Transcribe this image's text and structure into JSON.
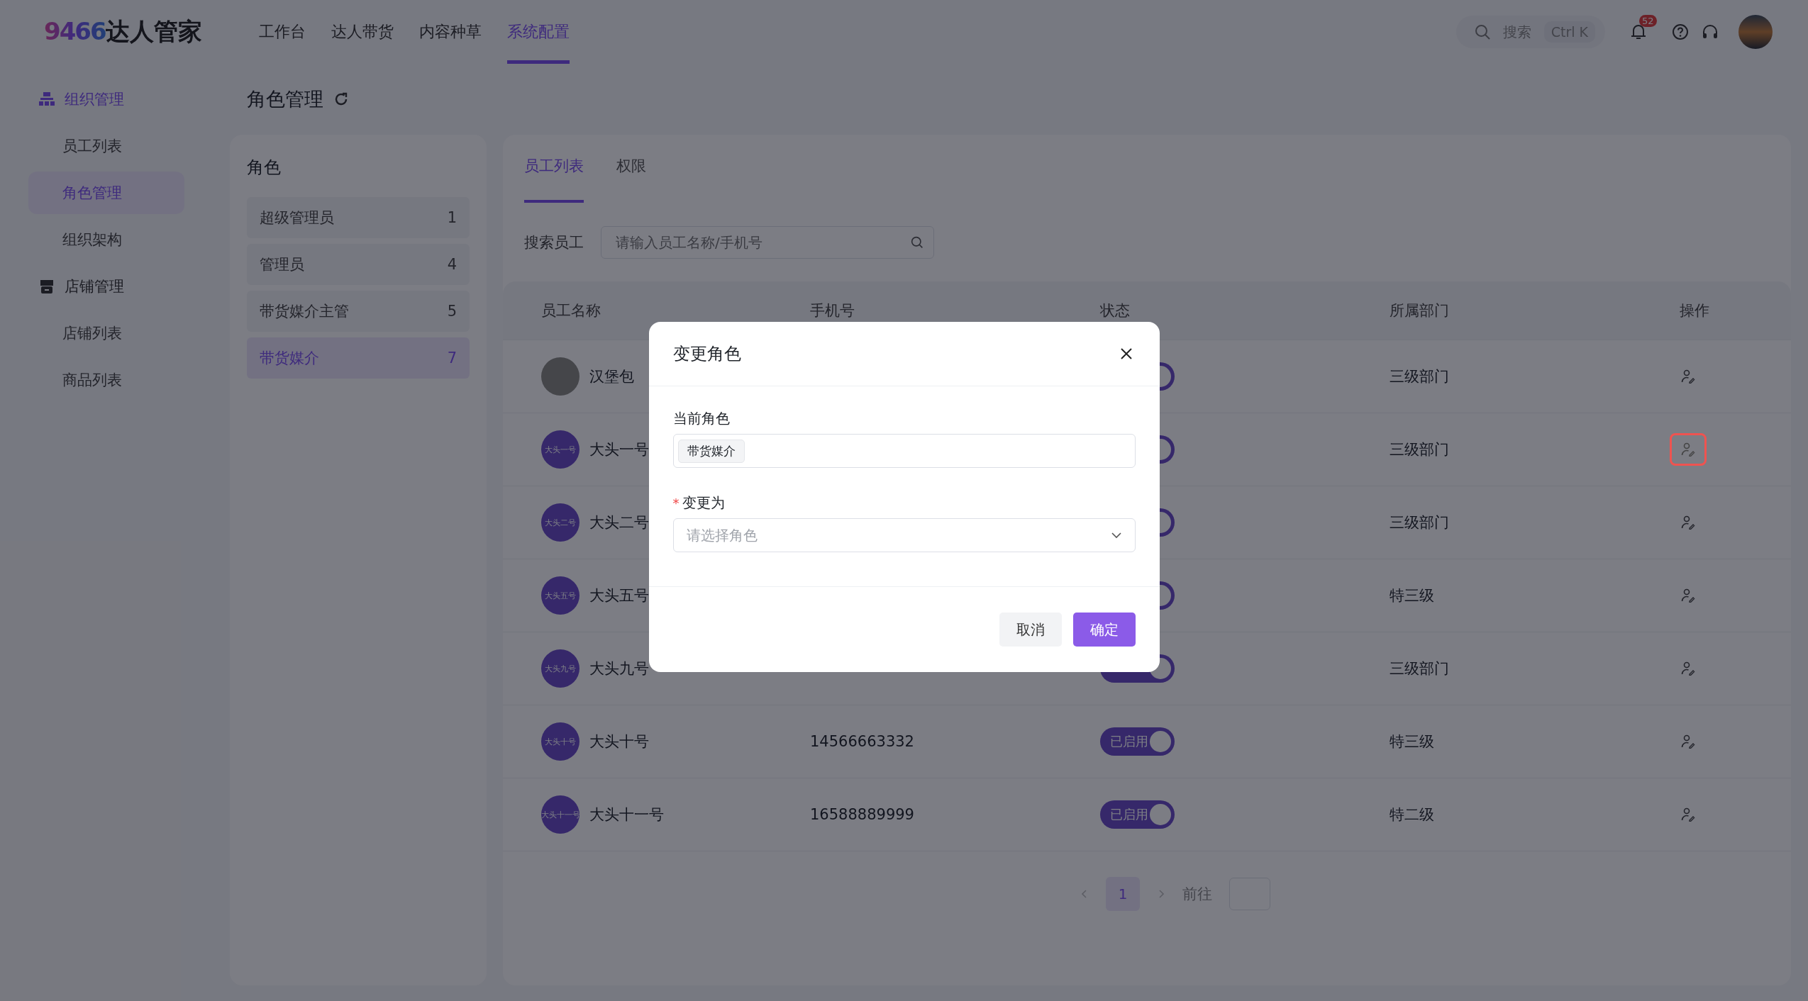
{
  "header": {
    "logo_digits": "9466",
    "logo_text": "达人管家",
    "nav": [
      {
        "label": "工作台",
        "selected": false
      },
      {
        "label": "达人带货",
        "selected": false
      },
      {
        "label": "内容种草",
        "selected": false
      },
      {
        "label": "系统配置",
        "selected": true
      }
    ],
    "search": {
      "placeholder": "搜索",
      "shortcut": "Ctrl K"
    },
    "notification_count": "52"
  },
  "sidebar": {
    "groups": [
      {
        "label": "组织管理",
        "kind": "org",
        "selected": true,
        "items": [
          {
            "label": "员工列表",
            "selected": false
          },
          {
            "label": "角色管理",
            "selected": true
          },
          {
            "label": "组织架构",
            "selected": false
          }
        ]
      },
      {
        "label": "店铺管理",
        "kind": "store",
        "selected": false,
        "items": [
          {
            "label": "店铺列表",
            "selected": false
          },
          {
            "label": "商品列表",
            "selected": false
          }
        ]
      }
    ]
  },
  "page": {
    "title": "角色管理"
  },
  "roles": {
    "title": "角色",
    "items": [
      {
        "name": "超级管理员",
        "count": "1",
        "selected": false
      },
      {
        "name": "管理员",
        "count": "4",
        "selected": false
      },
      {
        "name": "带货媒介主管",
        "count": "5",
        "selected": false
      },
      {
        "name": "带货媒介",
        "count": "7",
        "selected": true
      }
    ]
  },
  "tabs": [
    {
      "label": "员工列表",
      "selected": true
    },
    {
      "label": "权限",
      "selected": false
    }
  ],
  "search": {
    "label": "搜索员工",
    "placeholder": "请输入员工名称/手机号"
  },
  "table": {
    "columns": [
      "员工名称",
      "手机号",
      "状态",
      "所属部门",
      "操作"
    ],
    "rows": [
      {
        "avatar": {
          "kind": "photo"
        },
        "name": "汉堡包",
        "enabled": true,
        "department": "三级部门",
        "highlighted": false
      },
      {
        "avatar": {
          "kind": "text",
          "text": "大头一号"
        },
        "name": "大头一号",
        "enabled": true,
        "department": "三级部门",
        "highlighted": true
      },
      {
        "avatar": {
          "kind": "text",
          "text": "大头二号"
        },
        "name": "大头二号",
        "enabled": true,
        "department": "三级部门",
        "highlighted": false
      },
      {
        "avatar": {
          "kind": "text",
          "text": "大头五号"
        },
        "name": "大头五号",
        "enabled": true,
        "department": "特三级",
        "highlighted": false
      },
      {
        "avatar": {
          "kind": "text",
          "text": "大头九号"
        },
        "name": "大头九号",
        "enabled": true,
        "department": "三级部门",
        "highlighted": false
      },
      {
        "avatar": {
          "kind": "text",
          "text": "大头十号"
        },
        "name": "大头十号",
        "phone": "14566663332",
        "enabled": true,
        "status_label": "已启用",
        "department": "特三级",
        "highlighted": false
      },
      {
        "avatar": {
          "kind": "text",
          "text": "大头十一号"
        },
        "name": "大头十一号",
        "phone": "16588889999",
        "enabled": true,
        "status_label": "已启用",
        "department": "特二级",
        "highlighted": false
      }
    ]
  },
  "pagination": {
    "pages": [
      {
        "label": "1",
        "selected": true
      }
    ],
    "goto_label": "前往"
  },
  "dialog": {
    "title": "变更角色",
    "fields": [
      {
        "kind": "tags",
        "label": "当前角色",
        "tags": [
          "带货媒介"
        ]
      },
      {
        "kind": "select",
        "label": "变更为",
        "required_mark": "*",
        "placeholder": "请选择角色"
      }
    ],
    "buttons": [
      {
        "label": "取消",
        "kind": "secondary"
      },
      {
        "label": "确定",
        "kind": "primary"
      }
    ]
  }
}
